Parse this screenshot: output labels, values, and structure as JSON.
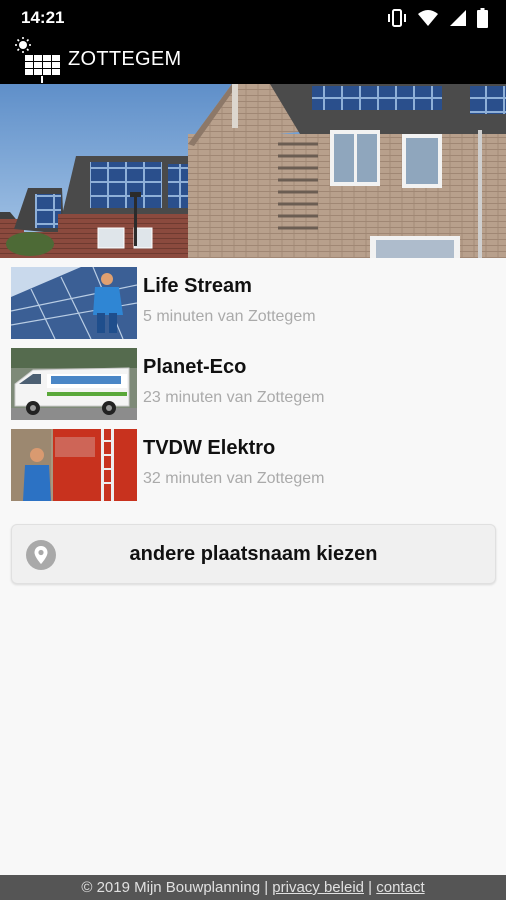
{
  "status": {
    "time": "14:21",
    "icons": [
      "vibrate-icon",
      "wifi-icon",
      "signal-icon",
      "battery-icon"
    ]
  },
  "app": {
    "title": "ZOTTEGEM",
    "logo_icon": "solar-panel-sun-icon"
  },
  "companies": [
    {
      "name": "Life Stream",
      "distance": "5 minuten van Zottegem",
      "thumb": "installer-on-solar-roof"
    },
    {
      "name": "Planet-Eco",
      "distance": "23 minuten van Zottegem",
      "thumb": "white-company-van"
    },
    {
      "name": "TVDW Elektro",
      "distance": "32 minuten van Zottegem",
      "thumb": "worker-beside-red-van"
    }
  ],
  "choose_place": {
    "label": "andere plaatsnaam kiezen",
    "icon": "location-pin-icon"
  },
  "footer": {
    "copyright": "© 2019 Mijn Bouwplanning |",
    "privacy": "privacy beleid",
    "separator": "|",
    "contact": "contact"
  },
  "colors": {
    "bar": "#000000",
    "footer": "#555555",
    "button_bg": "#f0f0f0",
    "pin": "#a9a9a9"
  }
}
